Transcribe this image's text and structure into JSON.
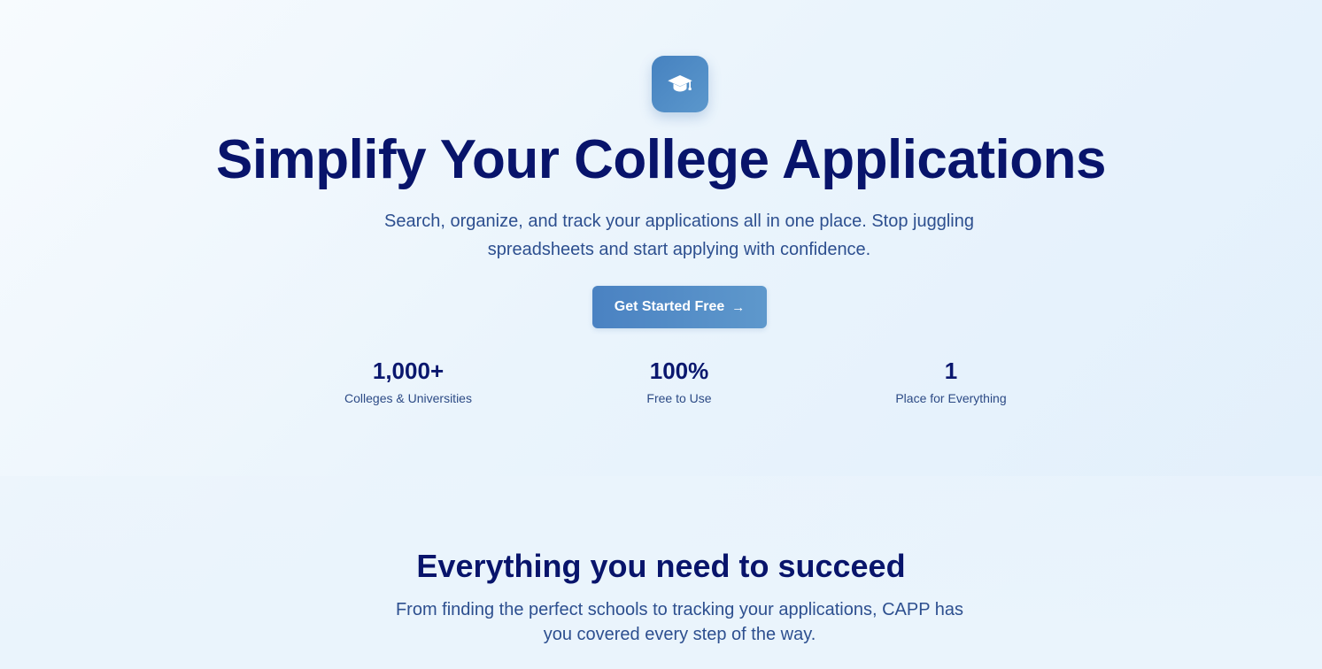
{
  "hero": {
    "logo_icon": "graduation-cap-icon",
    "title": "Simplify Your College Applications",
    "subtitle": "Search, organize, and track your applications all in one place. Stop juggling spreadsheets and start applying with confidence.",
    "cta_label": "Get Started Free",
    "cta_icon": "arrow-right-icon",
    "stats": [
      {
        "value": "1,000+",
        "label": "Colleges & Universities"
      },
      {
        "value": "100%",
        "label": "Free to Use"
      },
      {
        "value": "1",
        "label": "Place for Everything"
      }
    ]
  },
  "features": {
    "title": "Everything you need to succeed",
    "subtitle": "From finding the perfect schools to tracking your applications, CAPP has you covered every step of the way."
  },
  "colors": {
    "heading": "#08146b",
    "body_text": "#2d4f8f",
    "accent": "#4a82c2"
  }
}
